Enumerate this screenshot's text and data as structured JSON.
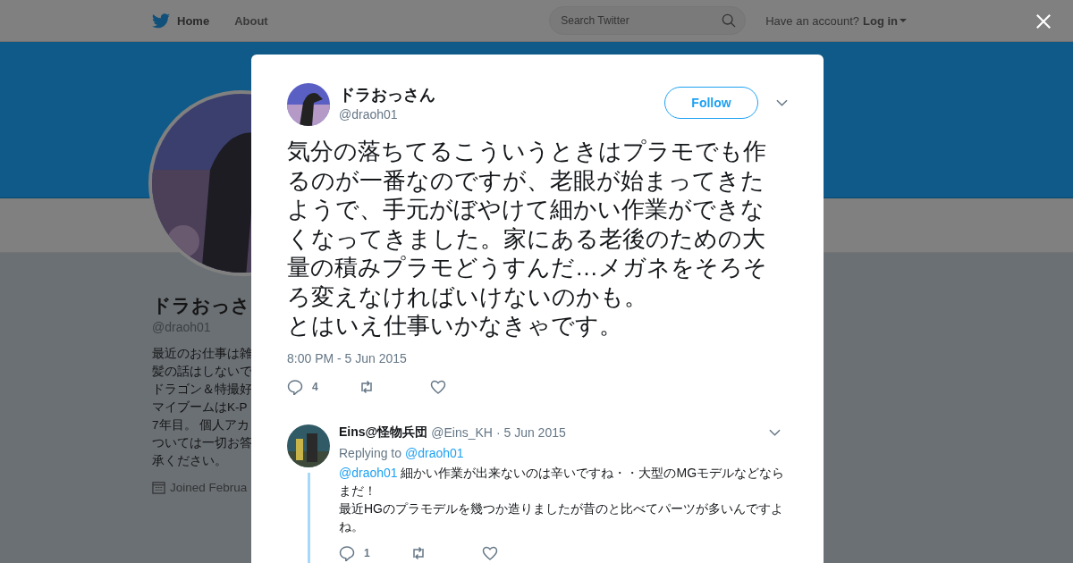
{
  "topbar": {
    "nav": [
      {
        "label": "Home",
        "selected": true
      },
      {
        "label": "About",
        "selected": false
      }
    ],
    "search": {
      "placeholder": "Search Twitter"
    },
    "account_prompt": "Have an account?",
    "login": "Log in"
  },
  "profile": {
    "name": "ドラおっさ",
    "handle": "@draoh01",
    "bio_lines": [
      "最近のお仕事は雑",
      "髪の話はしないで",
      "ドラゴン＆特撮好",
      "マイブームはK-P",
      "7年目。 個人アカ",
      "ついては一切お答",
      "承ください。"
    ],
    "joined": "Joined Februa"
  },
  "tweet": {
    "name": "ドラおっさん",
    "handle": "@draoh01",
    "follow": "Follow",
    "paragraphs": [
      "気分の落ちてるこういうときはプラモでも作るのが一番なのですが、老眼が始まってきたようで、手元がぼやけて細かい作業ができなくなってきました。家にある老後のための大量の積みプラモどうすんだ…メガネをそろそろ変えなければいけないのかも。",
      "とはいえ仕事いかなきゃです。"
    ],
    "time": "8:00 PM - 5 Jun 2015",
    "actions": [
      {
        "kind": "reply",
        "count": "4"
      },
      {
        "kind": "retweet"
      },
      {
        "kind": "like"
      }
    ]
  },
  "replies": [
    {
      "name": "Eins@怪物兵団",
      "handle": "@Eins_KH",
      "date": "· 5 Jun 2015",
      "replying_label": "Replying to",
      "replying_to": "@draoh01",
      "mention": "@draoh01",
      "paragraphs": [
        "細かい作業が出来ないのは辛いですね・・大型のMGモデルなどならまだ！",
        "最近HGのプラモデルを幾つか造りましたが昔のと比べてパーツが多いんですよね。"
      ],
      "actions": [
        {
          "kind": "reply",
          "count": "1"
        },
        {
          "kind": "retweet"
        },
        {
          "kind": "like"
        }
      ]
    }
  ]
}
